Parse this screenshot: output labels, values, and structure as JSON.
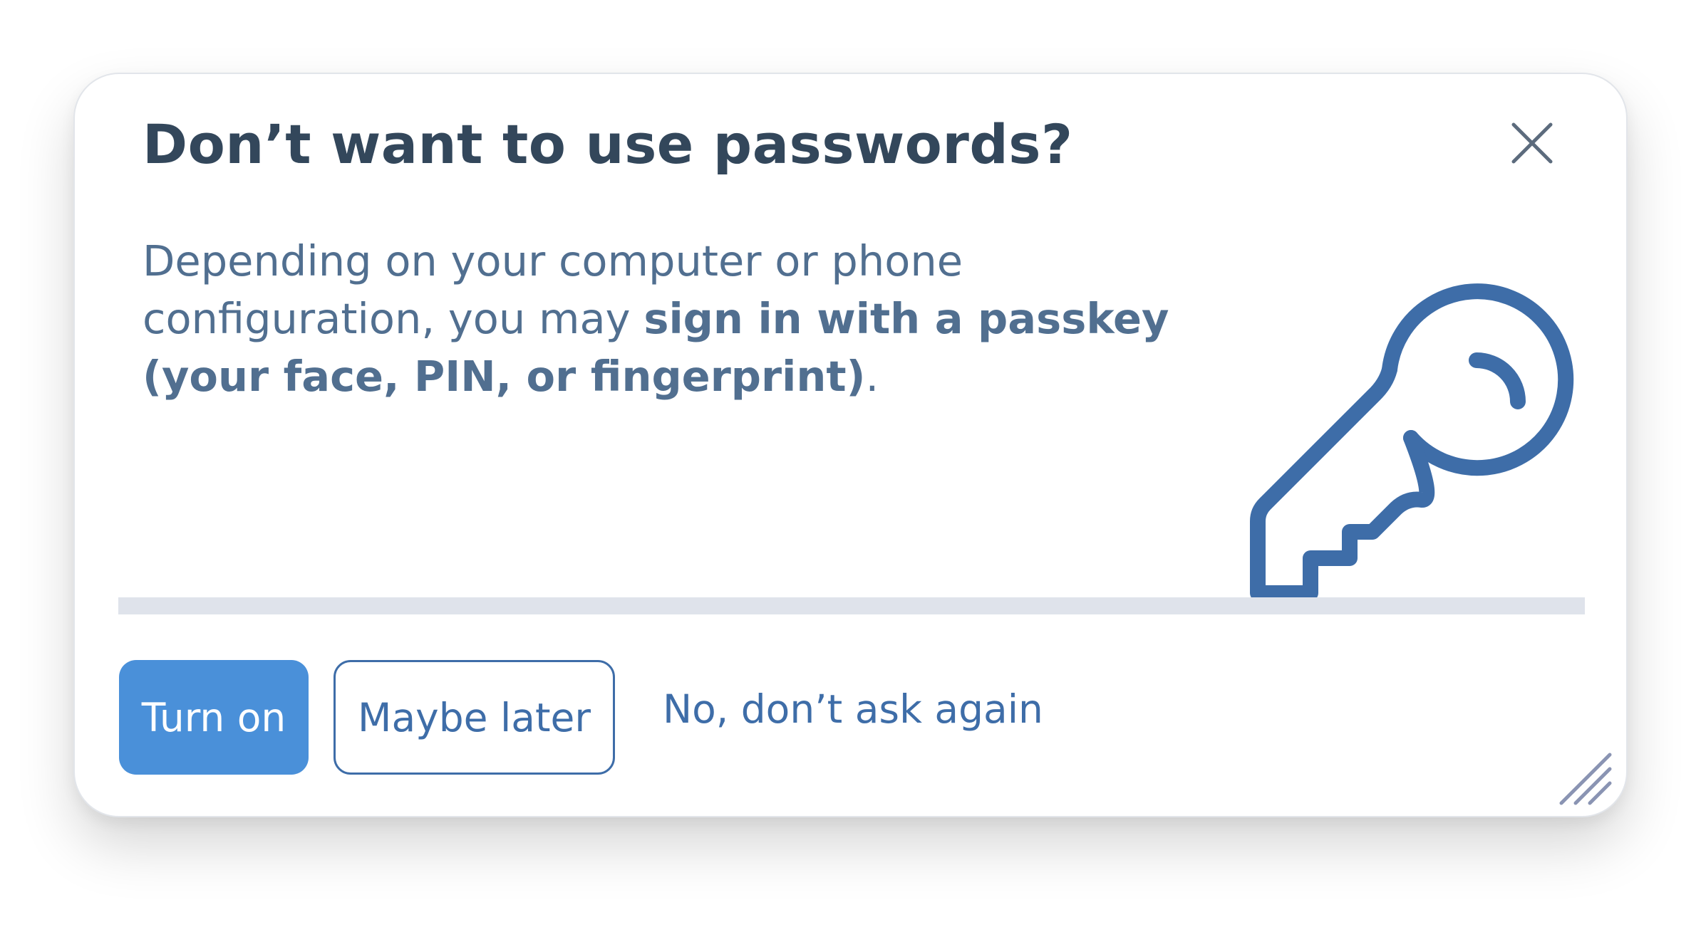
{
  "dialog": {
    "title": "Don’t want to use passwords?",
    "body_intro": "Depending on your computer or phone configuration, you may ",
    "body_bold": "sign in with a passkey (your face, PIN, or fingerprint)",
    "body_end": ".",
    "close_icon": "close-icon",
    "illustration_icon": "key-icon",
    "buttons": {
      "primary_label": "Turn on",
      "secondary_label": "Maybe later",
      "tertiary_label": "No, don’t ask again"
    },
    "resize_icon": "resize-handle-icon"
  },
  "colors": {
    "title": "#33475b",
    "body": "#516f90",
    "primary_button": "#4a90d9",
    "accent": "#3e6da8",
    "divider": "#dfe3eb",
    "close_icon": "#5c6b7d",
    "resize_icon": "#8a94b3"
  }
}
